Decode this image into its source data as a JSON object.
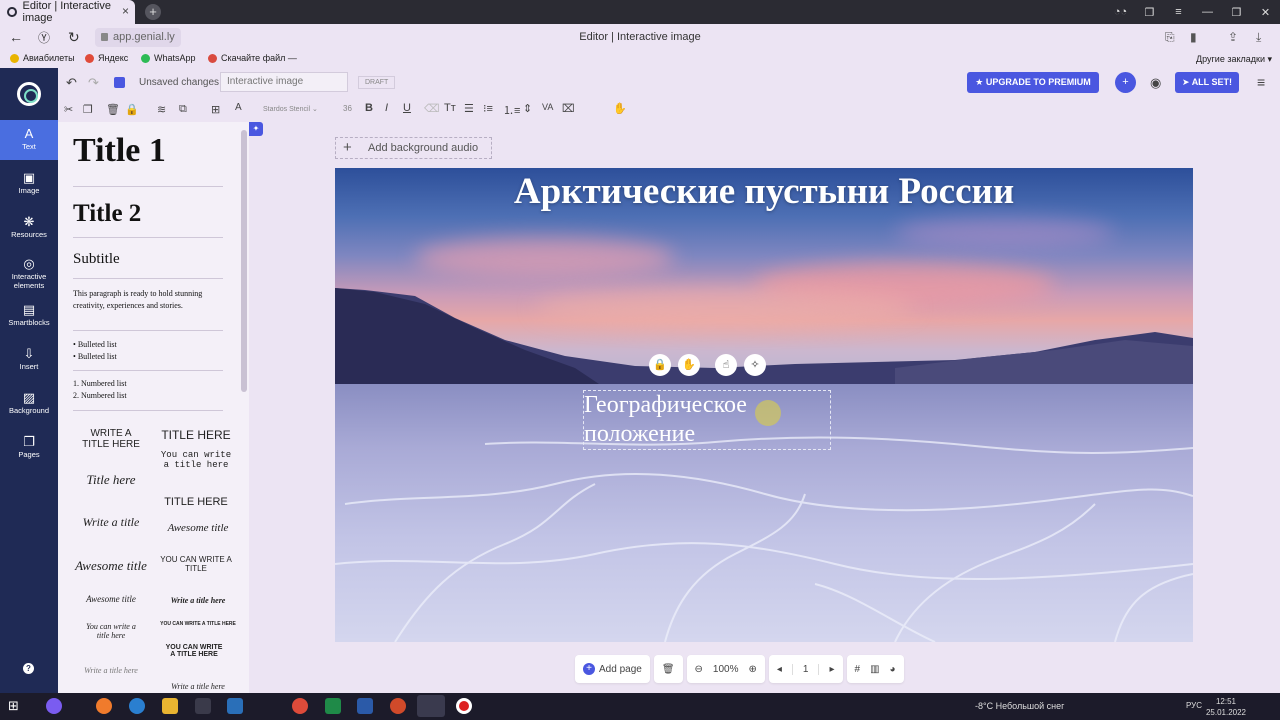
{
  "browser": {
    "tab_title": "Editor | Interactive image",
    "tab_close": "×",
    "new_tab": "+",
    "url": "app.genial.ly",
    "page_title": "Editor | Interactive image"
  },
  "bookmarks": {
    "items": [
      "Авиабилеты",
      "Яндекс",
      "WhatsApp",
      "Скачайте файл —"
    ],
    "other": "Другие закладки ▾"
  },
  "sidebar": {
    "items": [
      {
        "label": "Text",
        "icon": "A"
      },
      {
        "label": "Image",
        "icon": "▣"
      },
      {
        "label": "Resources",
        "icon": "❋"
      },
      {
        "label": "Interactive elements",
        "icon": "◎"
      },
      {
        "label": "Smartblocks",
        "icon": "▤"
      },
      {
        "label": "Insert",
        "icon": "⇩"
      },
      {
        "label": "Background",
        "icon": "▨"
      },
      {
        "label": "Pages",
        "icon": "❐"
      }
    ],
    "help": "?"
  },
  "toolbar": {
    "unsaved": "Unsaved changes",
    "project_name": "Interactive image",
    "draft": "DRAFT",
    "upgrade": "UPGRADE TO PREMIUM",
    "all_set": "ALL SET!",
    "font_name": "Stardos Stencil",
    "font_size": "36"
  },
  "panel": {
    "title1": "Title 1",
    "title2": "Title 2",
    "subtitle": "Subtitle",
    "paragraph": "This paragraph is ready to hold stunning creativity, experiences and stories.",
    "bullets": [
      "Bulleted list",
      "Bulleted list"
    ],
    "numbered": [
      "1. Numbered list",
      "2. Numbered list"
    ],
    "templates": [
      "WRITE A TITLE HERE",
      "TITLE HERE",
      "You can write a title here",
      "Title here",
      "TITLE HERE",
      "Write a title",
      "Awesome title",
      "Awesome title",
      "YOU CAN WRITE A TITLE",
      "Awesome title",
      "Write a title here",
      "You can write a title here",
      "YOU CAN WRITE A TITLE HERE",
      "YOU CAN WRITE A TITLE HERE",
      "Write a title here",
      "Write a title here"
    ]
  },
  "canvas": {
    "audio": "Add background audio",
    "title": "Арктические пустыни России",
    "text_lines": [
      "Географическое",
      "положение"
    ]
  },
  "bottombar": {
    "add_page": "Add page",
    "zoom": "100%",
    "page": "1"
  },
  "taskbar": {
    "weather": "-8°C  Небольшой снег",
    "lang": "РУС",
    "time": "12:51",
    "date": "25.01.2022"
  },
  "colors": {
    "sidebar_bg": "#1f2a55",
    "accent": "#4a57e0",
    "active_item": "#4a6ee0"
  }
}
